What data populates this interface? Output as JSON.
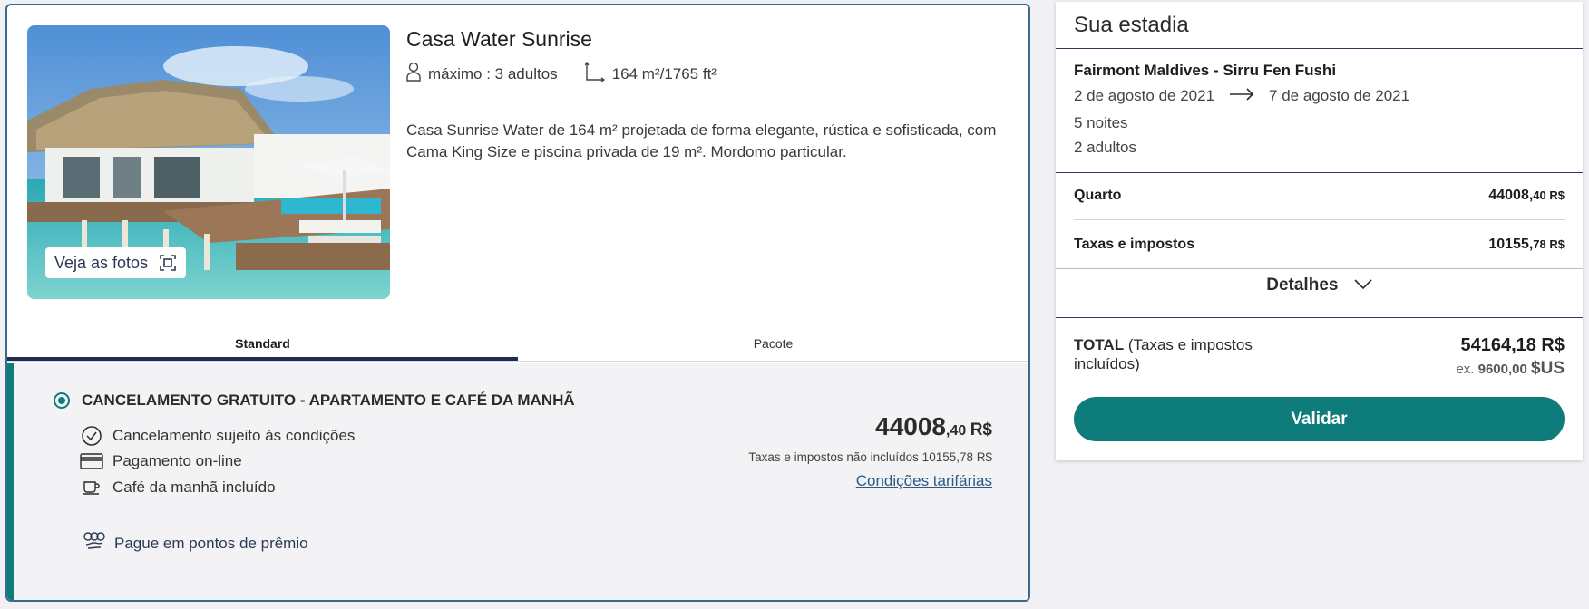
{
  "room": {
    "title": "Casa Water Sunrise",
    "capacity": "máximo : 3 adultos",
    "area": "164 m²/1765 ft²",
    "description": "Casa Sunrise Water de 164 m² projetada de forma elegante, rústica e sofisticada, com Cama King Size e piscina privada de 19 m². Mordomo particular.",
    "photos_button": "Veja as fotos"
  },
  "tabs": [
    {
      "label": "Standard",
      "active": true
    },
    {
      "label": "Pacote",
      "active": false
    }
  ],
  "rate": {
    "name": "CANCELAMENTO GRATUITO - APARTAMENTO E CAFÉ DA MANHÃ",
    "features": [
      {
        "icon": "clock-icon",
        "label": "Cancelamento sujeito às condições"
      },
      {
        "icon": "credit-card-icon",
        "label": "Pagamento on-line"
      },
      {
        "icon": "coffee-cup-icon",
        "label": "Café da manhã incluído"
      }
    ],
    "points_label": "Pague em pontos de prêmio",
    "price_int": "44008",
    "price_dec": ",40",
    "price_currency": "R$",
    "taxes_note": "Taxas e impostos não incluídos 10155,78 R$",
    "conditions_link": "Condições tarifárias"
  },
  "summary": {
    "title": "Sua estadia",
    "hotel": "Fairmont Maldives - Sirru Fen Fushi",
    "checkin": "2 de agosto de 2021",
    "checkout": "7 de agosto de 2021",
    "nights": "5 noites",
    "adults": "2 adultos",
    "room_label": "Quarto",
    "room_int": "44008,",
    "room_dec": "40 R$",
    "taxes_label": "Taxas e impostos",
    "taxes_int": "10155,",
    "taxes_dec": "78 R$",
    "details_label": "Detalhes",
    "total_label_bold": "TOTAL",
    "total_label_rest": "(Taxas e impostos incluídos)",
    "total_value": "54164,18 R$",
    "total_ex_prefix": "ex.",
    "total_ex_value": "9600,00",
    "total_ex_currency": "$US",
    "validate_label": "Validar"
  },
  "colors": {
    "accent": "#0e7c7b",
    "navy": "#1d2d4f",
    "link": "#2b5a85"
  }
}
